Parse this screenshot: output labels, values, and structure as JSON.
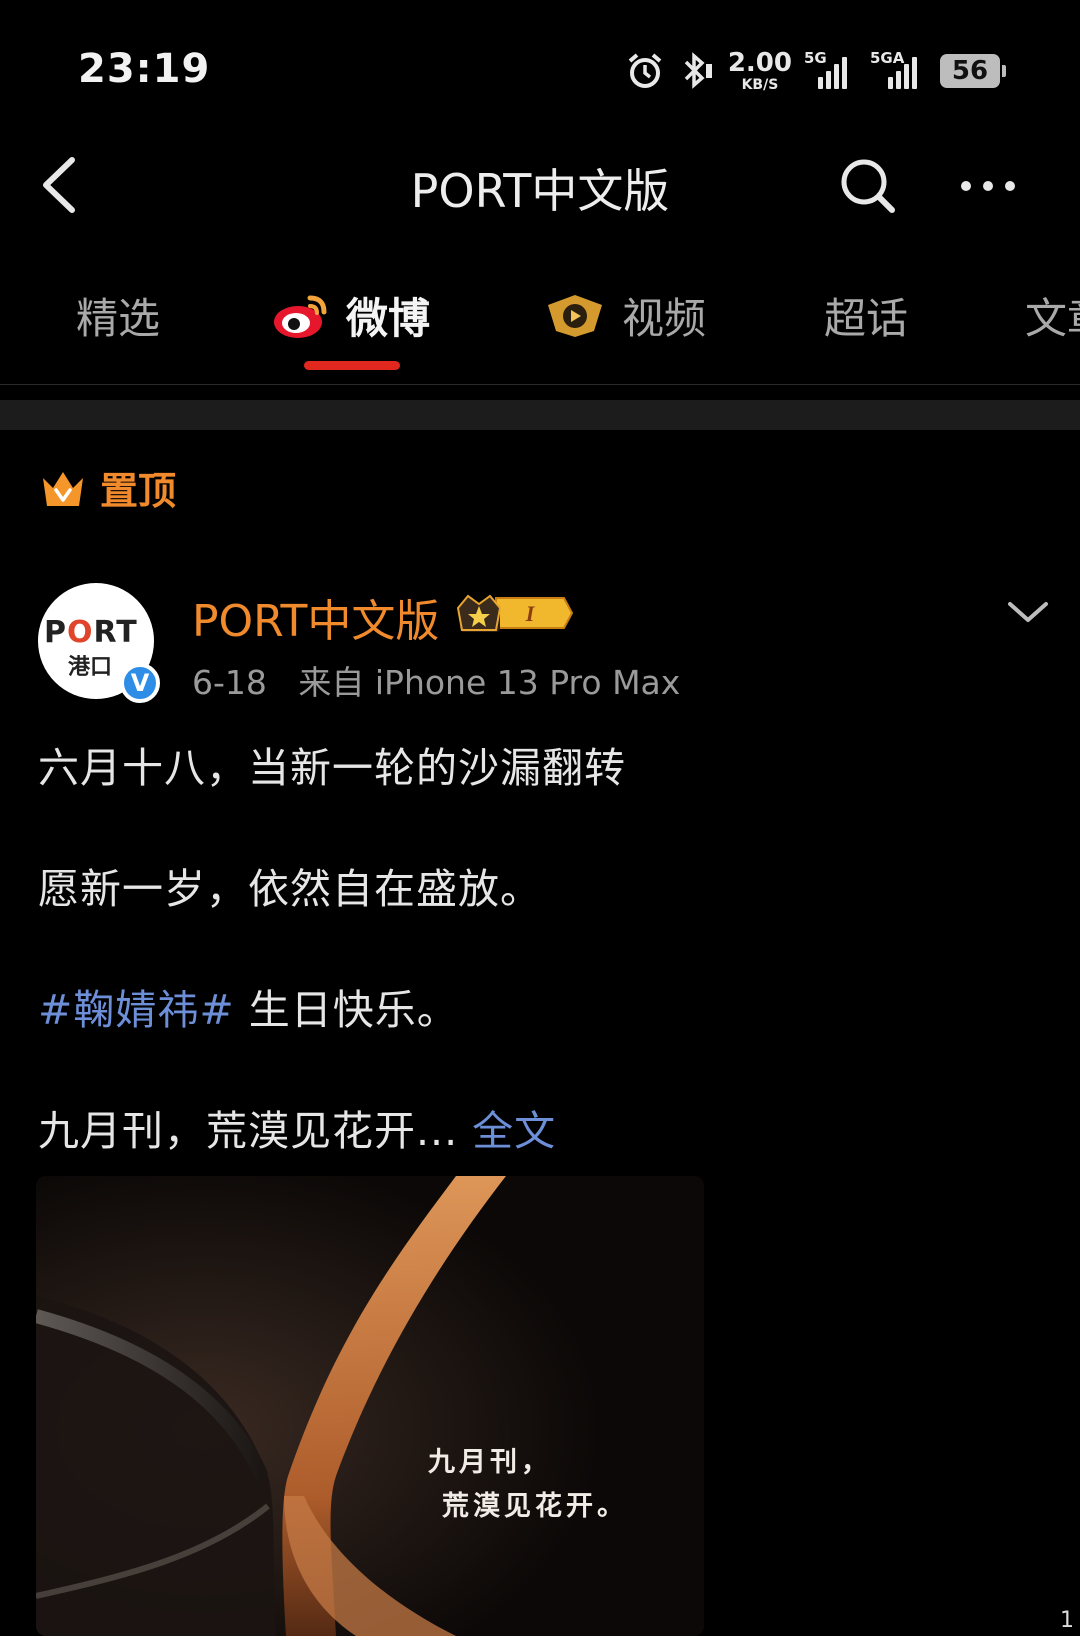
{
  "status_bar": {
    "time": "23:19",
    "net_speed_value": "2.00",
    "net_speed_unit": "KB/S",
    "sim1_label": "5G",
    "sim2_label": "5GA",
    "battery": "56"
  },
  "header": {
    "title": "PORT中文版"
  },
  "tabs": [
    {
      "label": "精选",
      "active": false
    },
    {
      "label": "微博",
      "active": true,
      "icon": "weibo-logo-icon"
    },
    {
      "label": "视频",
      "active": false,
      "icon": "video-play-icon"
    },
    {
      "label": "超话",
      "active": false
    },
    {
      "label": "文章",
      "active": false
    }
  ],
  "pinned": {
    "label": "置顶"
  },
  "post": {
    "author": "PORT中文版",
    "avatar": {
      "letters": [
        "P",
        "O",
        "R",
        "T"
      ],
      "cn": "港口"
    },
    "badge_text": "I",
    "verified_mark": "V",
    "date": "6-18",
    "source": "来自 iPhone 13 Pro Max",
    "lines": [
      "六月十八，当新一轮的沙漏翻转",
      "愿新一岁，依然自在盛放。"
    ],
    "hashtag": "#鞠婧祎#",
    "hashtag_suffix": " 生日快乐。",
    "excerpt": "九月刊，荒漠见花开...",
    "full_text_link": "全文",
    "image_caption_line1": "九月刊，",
    "image_caption_line2": "荒漠见花开。",
    "image_page_indicator": "1"
  },
  "colors": {
    "accent_orange": "#f08a2c",
    "link_blue": "#6d8fd8",
    "tab_indicator": "#e0281e",
    "verified_blue": "#2e8de6"
  }
}
